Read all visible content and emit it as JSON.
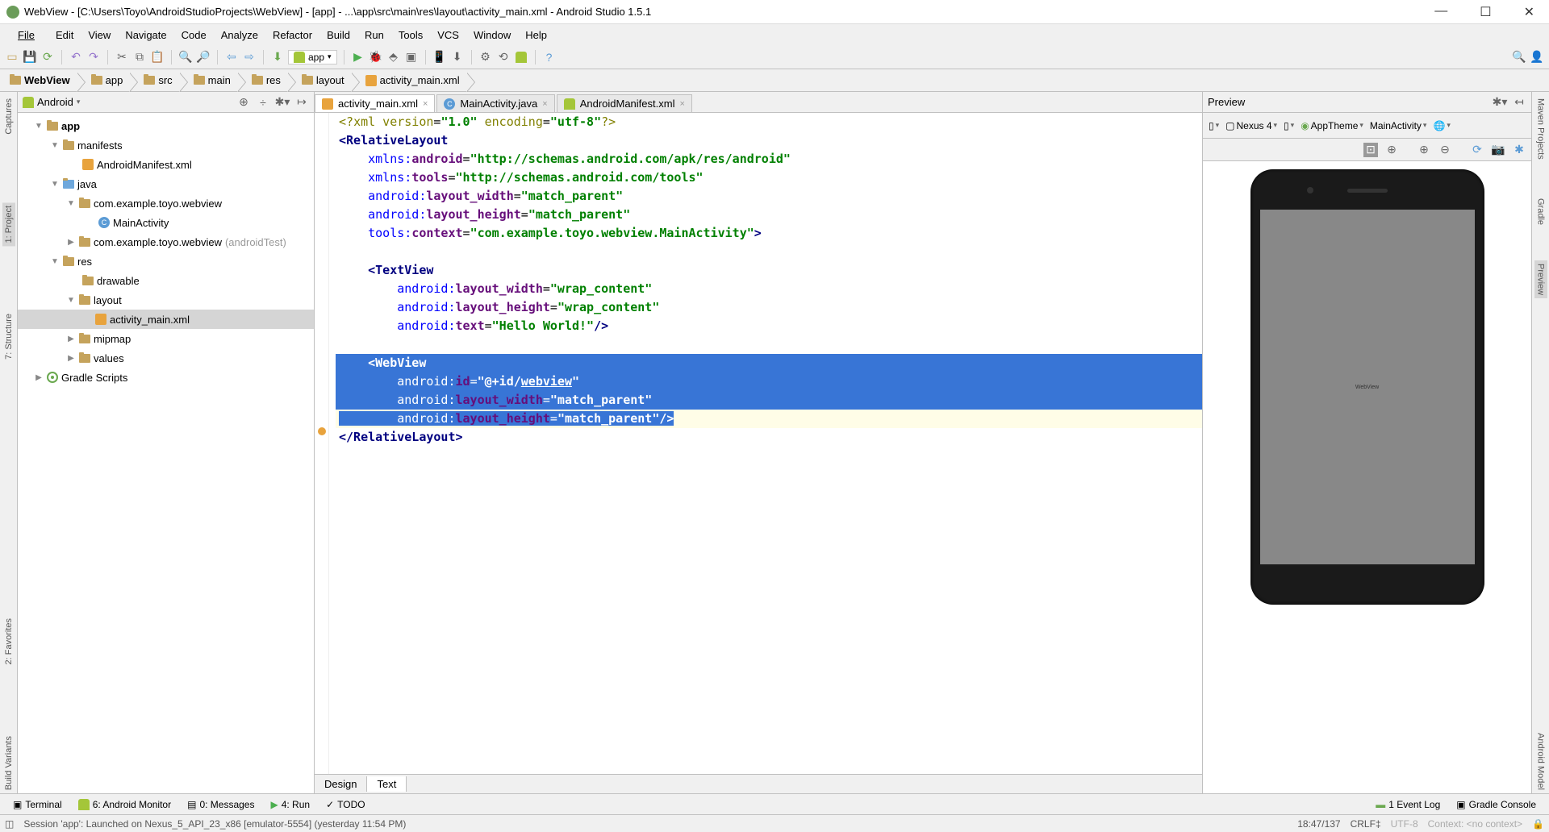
{
  "window_title": "WebView - [C:\\Users\\Toyo\\AndroidStudioProjects\\WebView] - [app] - ...\\app\\src\\main\\res\\layout\\activity_main.xml - Android Studio 1.5.1",
  "menubar": [
    "File",
    "Edit",
    "View",
    "Navigate",
    "Code",
    "Analyze",
    "Refactor",
    "Build",
    "Run",
    "Tools",
    "VCS",
    "Window",
    "Help"
  ],
  "run_config": "app",
  "breadcrumb": [
    "WebView",
    "app",
    "src",
    "main",
    "res",
    "layout",
    "activity_main.xml"
  ],
  "project_panel": {
    "mode": "Android",
    "tree": {
      "app": "app",
      "manifests": "manifests",
      "manifest_file": "AndroidManifest.xml",
      "java": "java",
      "pkg1": "com.example.toyo.webview",
      "main_activity": "MainActivity",
      "pkg2": "com.example.toyo.webview",
      "pkg2_suffix": "(androidTest)",
      "res": "res",
      "drawable": "drawable",
      "layout": "layout",
      "activity_main": "activity_main.xml",
      "mipmap": "mipmap",
      "values": "values",
      "gradle": "Gradle Scripts"
    }
  },
  "editor_tabs": [
    {
      "label": "activity_main.xml",
      "active": true,
      "icon": "xml"
    },
    {
      "label": "MainActivity.java",
      "active": false,
      "icon": "java"
    },
    {
      "label": "AndroidManifest.xml",
      "active": false,
      "icon": "xml"
    }
  ],
  "code": {
    "l1_a": "<?",
    "l1_b": "xml version",
    "l1_c": "=",
    "l1_d": "\"1.0\"",
    "l1_e": " encoding",
    "l1_f": "=",
    "l1_g": "\"utf-8\"",
    "l1_h": "?>",
    "l2": "<RelativeLayout",
    "l3_a": "    xmlns:",
    "l3_b": "android",
    "l3_c": "=",
    "l3_d": "\"http://schemas.android.com/apk/res/android\"",
    "l4_a": "    xmlns:",
    "l4_b": "tools",
    "l4_c": "=",
    "l4_d": "\"http://schemas.android.com/tools\"",
    "l5_a": "    android:",
    "l5_b": "layout_width",
    "l5_c": "=",
    "l5_d": "\"match_parent\"",
    "l6_a": "    android:",
    "l6_b": "layout_height",
    "l6_c": "=",
    "l6_d": "\"match_parent\"",
    "l7_a": "    tools:",
    "l7_b": "context",
    "l7_c": "=",
    "l7_d": "\"com.example.toyo.webview.MainActivity\"",
    "l7_e": ">",
    "l9": "    <TextView",
    "l10_a": "        android:",
    "l10_b": "layout_width",
    "l10_c": "=",
    "l10_d": "\"wrap_content\"",
    "l11_a": "        android:",
    "l11_b": "layout_height",
    "l11_c": "=",
    "l11_d": "\"wrap_content\"",
    "l12_a": "        android:",
    "l12_b": "text",
    "l12_c": "=",
    "l12_d": "\"Hello World!\"",
    "l12_e": "/>",
    "l15": "    <WebView",
    "l16_a": "        android:",
    "l16_b": "id",
    "l16_c": "=",
    "l16_d": "\"@+id/",
    "l16_e": "webview",
    "l16_f": "\"",
    "l17_a": "        android:",
    "l17_b": "layout_width",
    "l17_c": "=",
    "l17_d": "\"match_parent\"",
    "l18_a": "        android:",
    "l18_b": "layout_height",
    "l18_c": "=",
    "l18_d": "\"match_parent\"",
    "l18_e": "/>",
    "l19": "</RelativeLayout>"
  },
  "bottom_tabs": {
    "design": "Design",
    "text": "Text"
  },
  "preview": {
    "title": "Preview",
    "device": "Nexus 4",
    "theme": "AppTheme",
    "activity": "MainActivity",
    "screen_text": "WebView"
  },
  "left_rail": {
    "captures": "Captures",
    "project": "1: Project",
    "structure": "7: Structure",
    "favorites": "2: Favorites",
    "build_variants": "Build Variants"
  },
  "right_rail": {
    "maven": "Maven Projects",
    "gradle": "Gradle",
    "preview": "Preview",
    "android_model": "Android Model"
  },
  "bottom_bar": {
    "terminal": "Terminal",
    "monitor": "6: Android Monitor",
    "messages": "0: Messages",
    "run": "4: Run",
    "todo": "TODO",
    "event_log": "1 Event Log",
    "gradle_console": "Gradle Console"
  },
  "status": {
    "msg": "Session 'app': Launched on Nexus_5_API_23_x86 [emulator-5554] (yesterday 11:54 PM)",
    "pos": "18:47/137",
    "crlf": "CRLF",
    "enc": "UTF-8",
    "context": "Context: <no context>"
  }
}
